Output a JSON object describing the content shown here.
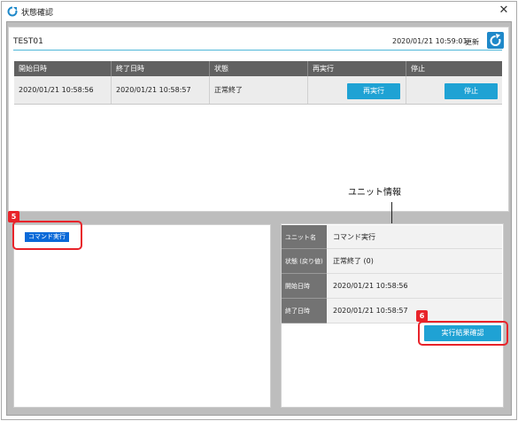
{
  "window": {
    "title": "状態確認",
    "close_glyph": "✕"
  },
  "job": {
    "name": "TEST01",
    "timestamp": "2020/01/21 10:59:01",
    "refresh_label": "更新"
  },
  "table": {
    "headers": [
      "開始日時",
      "終了日時",
      "状態",
      "再実行",
      "停止"
    ],
    "row": {
      "start": "2020/01/21 10:58:56",
      "end": "2020/01/21 10:58:57",
      "status": "正常終了",
      "rerun_label": "再実行",
      "stop_label": "停止"
    }
  },
  "unit_list": {
    "items": [
      "コマンド実行"
    ]
  },
  "unit_info": {
    "rows": [
      {
        "label": "ユニット名",
        "value": "コマンド実行"
      },
      {
        "label": "状態 (戻り値)",
        "value": "正常終了 (0)"
      },
      {
        "label": "開始日時",
        "value": "2020/01/21 10:58:56"
      },
      {
        "label": "終了日時",
        "value": "2020/01/21 10:58:57"
      }
    ],
    "result_button_label": "実行結果確認"
  },
  "annotations": {
    "label": "ユニット情報",
    "badge_5": "5",
    "badge_6": "6"
  },
  "colors": {
    "accent": "#1fa2d4",
    "highlight": "#e8232a",
    "header_bg": "#616161",
    "selected": "#0a69d8"
  },
  "icons": {
    "app": "circular-arrow-icon",
    "refresh": "refresh-icon",
    "close": "close-icon"
  }
}
